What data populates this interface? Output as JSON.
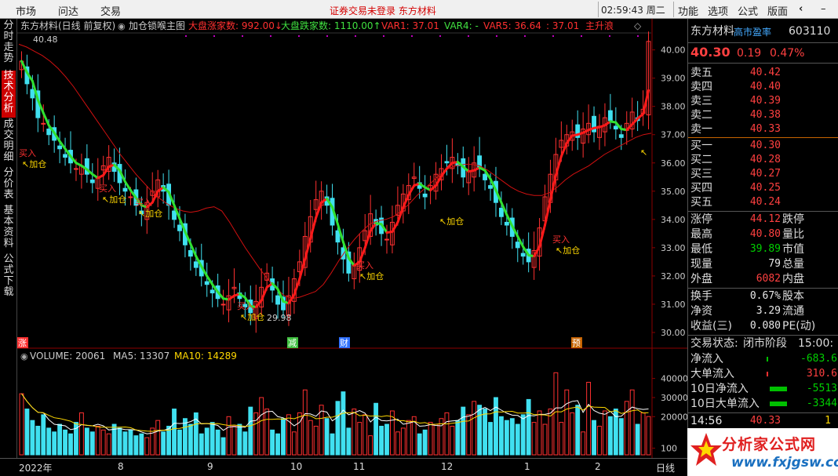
{
  "topbar": {
    "menu": [
      "市场",
      "问达",
      "交易"
    ],
    "title": "证券交易未登录  东方材料",
    "clock": "02:59:43 周二",
    "right_menu": [
      "功能",
      "选项",
      "公式",
      "版面"
    ],
    "controls": [
      "‹",
      "–",
      "▫",
      "×"
    ]
  },
  "left_tabs": [
    "分时走势",
    "技术分析",
    "成交明细",
    "分价表",
    "基本资料",
    "公式下载"
  ],
  "chart": {
    "header": "东方材料(日线 前复权)",
    "formula": "加仓锁喉主图",
    "items": [
      {
        "label": "大盘涨家数: 992.00↓",
        "color": "#ff3030"
      },
      {
        "label": "大盘跌家数: 1110.00↑",
        "color": "#40e040"
      },
      {
        "label": "VAR1: 37.01",
        "color": "#ff3030"
      },
      {
        "label": "VAR4: -",
        "color": "#40e040"
      },
      {
        "label": "VAR5: 36.64",
        "color": "#ff3030"
      },
      {
        "label": ": 37.01",
        "color": "#ff3030"
      },
      {
        "label": "主升浪",
        "color": "#ff3030"
      }
    ],
    "top_price_label": "40.48",
    "low_price_label": "29.98",
    "y_ticks": [
      "40.00",
      "39.00",
      "38.00",
      "37.00",
      "36.00",
      "35.00",
      "34.00",
      "33.00",
      "32.00",
      "31.00",
      "30.00"
    ],
    "signals": [
      "买入",
      "加仓"
    ],
    "markers": [
      "涨",
      "减",
      "财",
      "预"
    ]
  },
  "volume": {
    "label": "VOLUME: 20061",
    "ma5": "MA5: 13307",
    "ma10": "MA10: 14289",
    "y_ticks": [
      "40000",
      "30000",
      "20000",
      "100"
    ]
  },
  "bottom": {
    "labels": [
      "2022年",
      "8",
      "9",
      "10",
      "11",
      "12",
      "1",
      "2"
    ],
    "right": "日线"
  },
  "quote": {
    "name": "东方材料",
    "tag": "高市盈率",
    "code": "603110",
    "price": "40.30",
    "change": "0.19",
    "pct": "0.47%",
    "sell": [
      {
        "label": "卖五",
        "price": "40.42"
      },
      {
        "label": "卖四",
        "price": "40.40"
      },
      {
        "label": "卖三",
        "price": "40.39"
      },
      {
        "label": "卖二",
        "price": "40.38"
      },
      {
        "label": "卖一",
        "price": "40.33"
      }
    ],
    "buy": [
      {
        "label": "买一",
        "price": "40.30"
      },
      {
        "label": "买二",
        "price": "40.28"
      },
      {
        "label": "买三",
        "price": "40.27"
      },
      {
        "label": "买四",
        "price": "40.25"
      },
      {
        "label": "买五",
        "price": "40.24"
      }
    ],
    "stats": [
      {
        "l": "涨停",
        "v": "44.12",
        "r": "跌停",
        "c": "red"
      },
      {
        "l": "最高",
        "v": "40.80",
        "r": "量比",
        "c": "red"
      },
      {
        "l": "最低",
        "v": "39.89",
        "r": "市值",
        "c": "green"
      },
      {
        "l": "现量",
        "v": "79",
        "r": "总量",
        "c": "white"
      },
      {
        "l": "外盘",
        "v": "6082",
        "r": "内盘",
        "c": "red"
      }
    ],
    "stats2": [
      {
        "l": "换手",
        "v": "0.67%",
        "r": "股本"
      },
      {
        "l": "净资",
        "v": "3.29",
        "r": "流通"
      },
      {
        "l": "收益(三)",
        "v": "0.080",
        "r": "PE(动)"
      }
    ],
    "status_label": "交易状态:",
    "status_value": "闭市阶段",
    "status_time": "15:00:",
    "flows": [
      {
        "l": "净流入",
        "v": "-683.6",
        "c": "green"
      },
      {
        "l": "大单流入",
        "v": "310.6",
        "c": "red"
      },
      {
        "l": "10日净流入",
        "v": "-5513",
        "c": "green"
      },
      {
        "l": "10日大单流入",
        "v": "-3344",
        "c": "green"
      }
    ],
    "tick": {
      "time": "14:56",
      "price": "40.33",
      "vol": "1"
    }
  },
  "watermark": {
    "line1": "分析家公式网",
    "line2": "www.fxjgsw.com"
  },
  "chart_data": {
    "type": "candlestick",
    "title": "东方材料(日线 前复权)",
    "ylim": [
      29.5,
      40.6
    ],
    "x_labels": [
      "2022年",
      "8",
      "9",
      "10",
      "11",
      "12",
      "1",
      "2"
    ],
    "close": [
      39.6,
      38.8,
      38.3,
      37.6,
      37.4,
      37.0,
      36.8,
      36.5,
      36.2,
      36.0,
      35.8,
      35.9,
      35.6,
      35.3,
      35.5,
      35.9,
      36.2,
      35.7,
      35.3,
      35.0,
      34.8,
      34.5,
      34.2,
      34.6,
      35.0,
      35.4,
      35.0,
      34.5,
      34.0,
      33.6,
      33.1,
      32.7,
      32.3,
      32.0,
      31.7,
      31.4,
      31.2,
      31.0,
      31.3,
      31.6,
      31.2,
      30.9,
      30.7,
      31.1,
      31.6,
      32.1,
      31.5,
      31.0,
      30.8,
      31.3,
      31.9,
      32.5,
      33.4,
      34.1,
      34.7,
      35.0,
      34.5,
      33.8,
      33.2,
      32.6,
      32.1,
      32.4,
      33.0,
      33.6,
      34.2,
      33.8,
      33.5,
      33.3,
      33.9,
      34.5,
      34.9,
      35.2,
      35.5,
      35.1,
      34.8,
      35.2,
      35.6,
      35.8,
      36.0,
      36.2,
      35.9,
      35.5,
      35.7,
      36.0,
      35.8,
      35.4,
      35.1,
      34.6,
      34.1,
      33.8,
      33.4,
      33.0,
      32.7,
      32.5,
      32.9,
      33.7,
      34.8,
      35.6,
      36.3,
      36.8,
      37.0,
      37.1,
      36.9,
      37.2,
      37.4,
      37.1,
      37.3,
      37.6,
      37.5,
      37.2,
      36.9,
      37.4,
      37.8,
      37.5,
      37.9,
      40.3
    ],
    "ma_line": [
      40.2,
      40.1,
      39.95,
      39.8,
      39.6,
      39.35,
      39.05,
      38.7,
      38.3,
      37.9,
      37.5,
      37.1,
      36.7,
      36.3,
      35.95,
      35.6,
      35.3,
      35.0,
      34.75,
      34.55,
      34.4,
      34.3,
      34.25,
      34.3,
      34.4,
      34.45,
      34.3,
      33.9,
      33.45,
      33.0,
      32.6,
      32.2,
      31.85,
      31.55,
      31.3,
      31.2,
      31.25,
      31.35,
      31.45,
      31.7,
      32.1,
      32.55,
      32.95,
      33.3,
      33.6,
      33.85,
      33.95,
      34.0,
      34.1,
      34.3,
      34.55,
      34.85,
      35.1,
      35.35,
      35.6,
      35.8,
      35.9,
      35.95,
      35.95,
      35.9,
      35.75,
      35.55,
      35.35,
      35.15,
      35.0,
      34.9,
      34.85,
      34.85,
      34.95,
      35.15,
      35.4,
      35.6,
      35.75,
      35.9,
      36.1,
      36.3,
      36.45,
      36.6,
      36.75,
      36.9,
      37.0,
      37.05
    ],
    "volume": [
      32000,
      24000,
      18000,
      15000,
      21000,
      14000,
      12000,
      16000,
      13000,
      11000,
      17000,
      22000,
      14000,
      12000,
      15000,
      13000,
      11000,
      16000,
      14000,
      12000,
      13000,
      10000,
      11000,
      9000,
      14000,
      18000,
      12000,
      15000,
      24000,
      13000,
      19000,
      16000,
      22000,
      11000,
      14000,
      17000,
      13000,
      9000,
      20000,
      15000,
      16000,
      12000,
      25000,
      22000,
      30000,
      24000,
      13000,
      11000,
      19000,
      21000,
      12000,
      22000,
      34000,
      18000,
      15000,
      26000,
      19000,
      11000,
      28000,
      33000,
      14000,
      24000,
      17000,
      21000,
      10000,
      27000,
      15000,
      16000,
      23000,
      12000,
      14000,
      18000,
      20000,
      11000,
      13000,
      17000,
      16000,
      19000,
      22000,
      15000,
      18000,
      25000,
      21000,
      28000,
      26000,
      24000,
      17000,
      30000,
      20000,
      18000,
      19000,
      16000,
      21000,
      29000,
      17000,
      23000,
      16000,
      24000,
      43000,
      17000,
      34000,
      22000,
      26000,
      12000,
      38000,
      18000,
      15000,
      23000,
      20000,
      24000,
      19000,
      28000,
      34000,
      16000,
      22000,
      20061
    ]
  }
}
